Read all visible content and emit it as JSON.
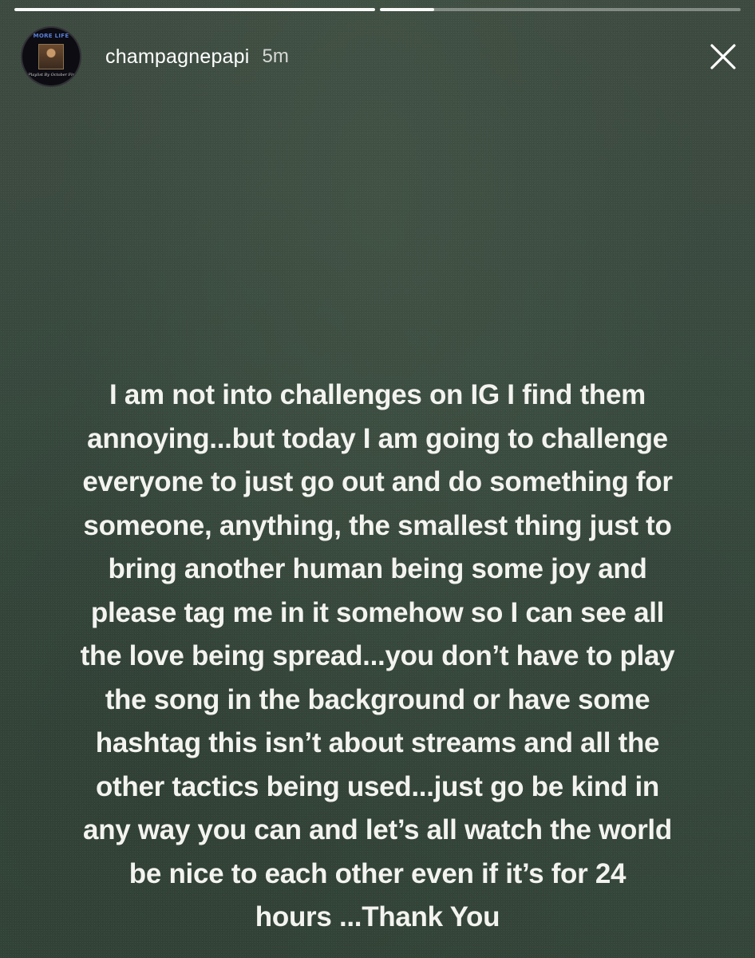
{
  "story": {
    "progress": [
      1.0,
      0.15
    ],
    "username": "champagnepapi",
    "timestamp": "5m",
    "avatar": {
      "title_text": "MORE LIFE",
      "script_text": "A Playlist By October Firm"
    },
    "icons": {
      "close": "close-icon"
    },
    "caption_lines": [
      "I am not into challenges on IG I find them",
      "annoying...but today I am going to challenge",
      "everyone to just go out and do something for",
      "someone, anything, the smallest thing just to",
      "bring another human being some joy and",
      "please tag me in it somehow so I can see all",
      "the love being spread...you don’t have to play",
      "the song in the background or have some",
      "hashtag this isn’t about streams and all the",
      "other tactics being used...just go be kind in",
      "any way you can and let’s all watch the world",
      "be nice to each other even if it’s for 24",
      "hours ...Thank You"
    ]
  },
  "colors": {
    "background": "#3a4b40",
    "text": "#f3f3f0",
    "progress_track": "#ffffff59",
    "progress_fill": "#fffffff2"
  }
}
